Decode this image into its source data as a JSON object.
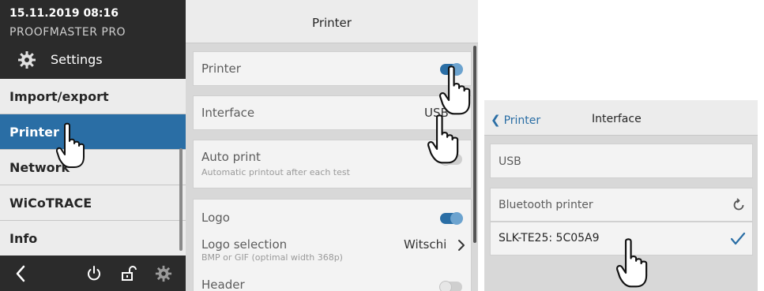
{
  "status": {
    "datetime": "15.11.2019 08:16",
    "device_name": "PROOFMASTER PRO"
  },
  "sidebar": {
    "section_title": "Settings",
    "items": [
      {
        "label": "Import/export",
        "active": false
      },
      {
        "label": "Printer",
        "active": true
      },
      {
        "label": "Network",
        "active": false
      },
      {
        "label": "WiCoTRACE",
        "active": false
      },
      {
        "label": "Info",
        "active": false
      }
    ],
    "footer_icons": [
      "back-icon",
      "power-icon",
      "unlock-icon",
      "gear-icon"
    ]
  },
  "printer_panel": {
    "title": "Printer",
    "printer": {
      "label": "Printer",
      "enabled": true
    },
    "interface": {
      "label": "Interface",
      "value": "USB"
    },
    "auto_print": {
      "label": "Auto print",
      "description": "Automatic printout after each test",
      "enabled": false
    },
    "logo": {
      "label": "Logo",
      "enabled": true
    },
    "logo_selection": {
      "label": "Logo selection",
      "description": "BMP or GIF (optimal width 368p)",
      "value": "Witschi"
    },
    "header": {
      "label": "Header",
      "enabled": false
    }
  },
  "interface_panel": {
    "back_label": "Printer",
    "title": "Interface",
    "usb_label": "USB",
    "bluetooth_label": "Bluetooth printer",
    "device_label": "SLK-TE25: 5C05A9",
    "device_selected": true
  },
  "colors": {
    "accent": "#2a6ea5",
    "dark_header": "#2b2b2b",
    "background": "#d8d8d8"
  }
}
